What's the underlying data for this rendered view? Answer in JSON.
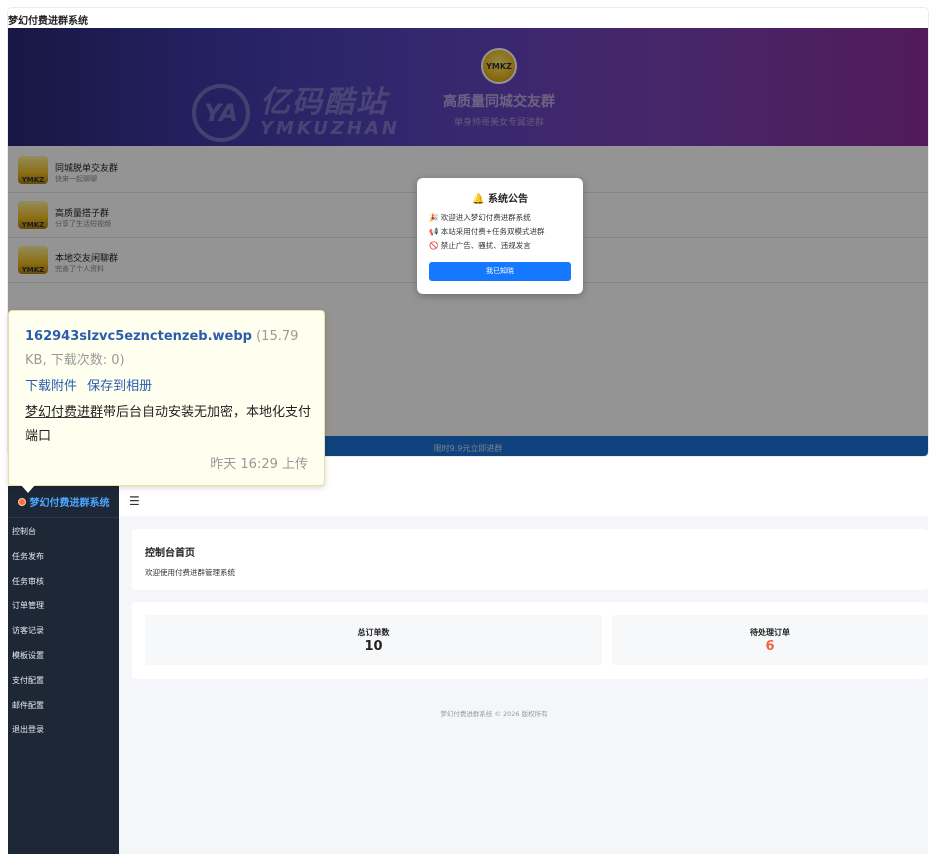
{
  "site_title": "梦幻付费进群系统",
  "banner": {
    "watermark_cn": "亿码酷站",
    "watermark_en": "YMKUZHAN",
    "watermark_mark": "YA",
    "logo_text": "YMKZ",
    "title": "高质量同城交友群",
    "subtitle": "单身帅哥美女专属进群"
  },
  "groups": [
    {
      "name": "同城脱单交友群",
      "desc": "快来一起聊聊",
      "thumb": "YMKZ"
    },
    {
      "name": "高质量搭子群",
      "desc": "分享了生活短视频",
      "thumb": "YMKZ"
    },
    {
      "name": "本地交友闲聊群",
      "desc": "完善了个人资料",
      "thumb": "YMKZ"
    }
  ],
  "bottom_bar": "限时9.9元立即进群",
  "notice": {
    "title": "系统公告",
    "lines": [
      {
        "icon": "🎉",
        "text": "欢迎进入梦幻付费进群系统"
      },
      {
        "icon": "📢",
        "text": "本站采用付费+任务双模式进群"
      },
      {
        "icon": "🚫",
        "text": "禁止广告、骚扰、违规发言"
      }
    ],
    "button": "我已知晓"
  },
  "attachment": {
    "filename": "162943slzvc5eznctenzeb.webp",
    "meta": "(15.79 KB, 下载次数: 0)",
    "download": "下载附件",
    "save": "保存到相册",
    "desc_underlined": "梦幻付费进群",
    "desc_rest": "带后台自动安装无加密，本地化支付端口",
    "time": "昨天 16:29 上传"
  },
  "admin": {
    "brand": "梦幻付费进群系统",
    "menu": [
      "控制台",
      "任务发布",
      "任务审核",
      "订单管理",
      "访客记录",
      "模板设置",
      "支付配置",
      "邮件配置",
      "退出登录"
    ],
    "hamburger": "☰",
    "dashboard_title": "控制台首页",
    "dashboard_sub": "欢迎使用付费进群管理系统",
    "stats": [
      {
        "label": "总订单数",
        "value": "10"
      },
      {
        "label": "待处理订单",
        "value": "6"
      }
    ],
    "footer": "梦幻付费进群系统 © 2026 版权所有"
  }
}
